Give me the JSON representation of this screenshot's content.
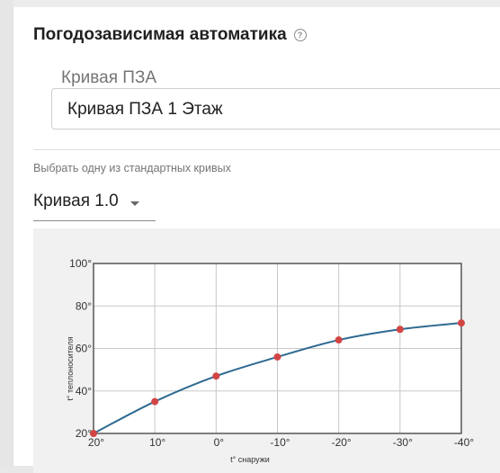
{
  "section": {
    "title": "Погодозависимая автоматика",
    "help_icon": "question-circle-icon"
  },
  "curve_field": {
    "label": "Кривая ПЗА",
    "value": "Кривая ПЗА 1 Этаж"
  },
  "preset": {
    "caption": "Выбрать одну из стандартных кривых",
    "value": "Кривая 1.0",
    "icon": "chevron-down-icon"
  },
  "colors": {
    "line": "#2e6a91",
    "point": "#d24545",
    "panel": "#f1f1f1"
  },
  "chart_data": {
    "type": "line",
    "xlabel": "t° снаружи",
    "ylabel": "t° теплоносителя",
    "x_tick_labels": [
      "20°",
      "10°",
      "0°",
      "-10°",
      "-20°",
      "-30°",
      "-40°"
    ],
    "y_tick_labels": [
      "20°",
      "40°",
      "60°",
      "80°",
      "100°"
    ],
    "x": [
      20,
      10,
      0,
      -10,
      -20,
      -30,
      -40
    ],
    "values": [
      20,
      35,
      47,
      56,
      64,
      69,
      72
    ],
    "xlim": [
      20,
      -40
    ],
    "ylim": [
      20,
      100
    ],
    "grid": true,
    "legend": "none"
  }
}
